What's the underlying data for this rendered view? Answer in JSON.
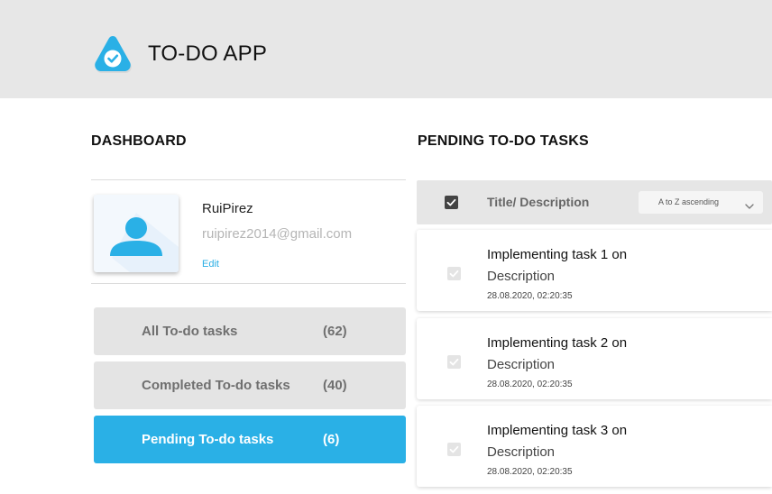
{
  "app": {
    "title": "TO-DO APP",
    "logo_icon": "check-triangle-logo",
    "accent_color": "#2ab0e6"
  },
  "dashboard": {
    "title": "DASHBOARD",
    "profile": {
      "username": "RuiPirez",
      "email": "ruipirez2014@gmail.com",
      "edit_label": "Edit",
      "avatar_icon": "user-icon"
    },
    "filters": [
      {
        "label": "All To-do tasks",
        "count": "(62)",
        "active": false
      },
      {
        "label": "Completed To-do tasks",
        "count": "(40)",
        "active": false
      },
      {
        "label": "Pending To-do tasks",
        "count": "(6)",
        "active": true
      }
    ]
  },
  "pending": {
    "title": "PENDING TO-DO TASKS",
    "table_header": {
      "column_title": "Title/ Description",
      "sort_value": "A to Z ascending",
      "select_all_checked": true
    },
    "tasks": [
      {
        "title": "Implementing task 1 on",
        "description": "Description",
        "date": "28.08.2020, 02:20:35",
        "checked": true
      },
      {
        "title": "Implementing task 2 on",
        "description": "Description",
        "date": "28.08.2020, 02:20:35",
        "checked": true
      },
      {
        "title": "Implementing task 3 on",
        "description": "Description",
        "date": "28.08.2020, 02:20:35",
        "checked": true
      }
    ]
  }
}
